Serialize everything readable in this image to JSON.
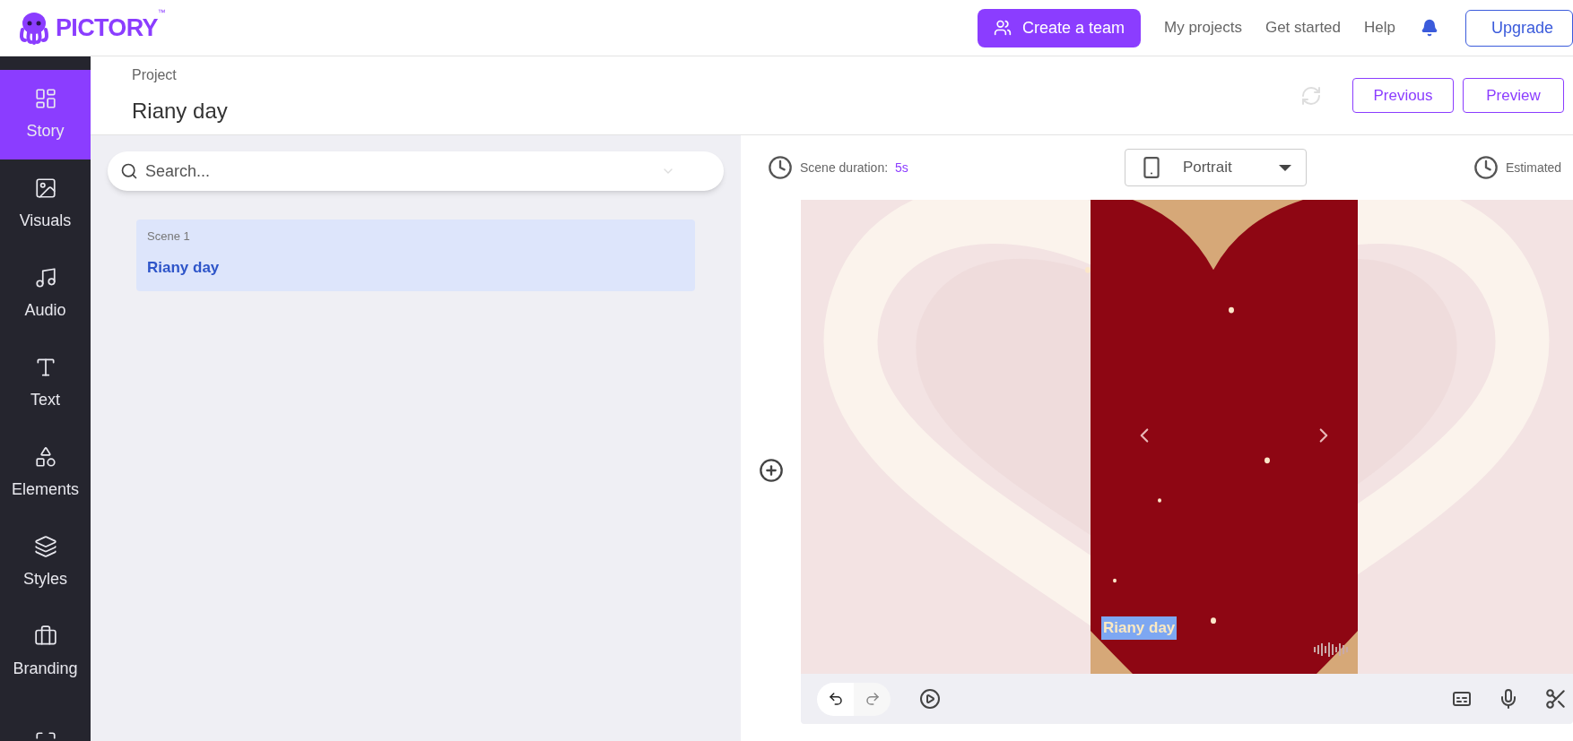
{
  "header": {
    "logo": "PICTORY",
    "trademark": "™",
    "create_team": "Create a team",
    "links": [
      "My projects",
      "Get started",
      "Help"
    ],
    "upgrade": "Upgrade"
  },
  "sidebar": {
    "items": [
      {
        "label": "Story",
        "selected": true
      },
      {
        "label": "Visuals",
        "selected": false
      },
      {
        "label": "Audio",
        "selected": false
      },
      {
        "label": "Text",
        "selected": false
      },
      {
        "label": "Elements",
        "selected": false
      },
      {
        "label": "Styles",
        "selected": false
      },
      {
        "label": "Branding",
        "selected": false
      },
      {
        "selected": false
      }
    ]
  },
  "project": {
    "caption": "Project",
    "title": "Riany day",
    "buttons": [
      "Previous",
      "Preview"
    ]
  },
  "search": {
    "placeholder": "Search..."
  },
  "scenes": [
    {
      "number": "Scene 1",
      "title": "Riany day",
      "selected": true
    }
  ],
  "preview": {
    "duration_label": "Scene duration:",
    "duration": "5s",
    "aspect": "Portrait",
    "estimated": "Estimated",
    "caption": "Riany day"
  }
}
